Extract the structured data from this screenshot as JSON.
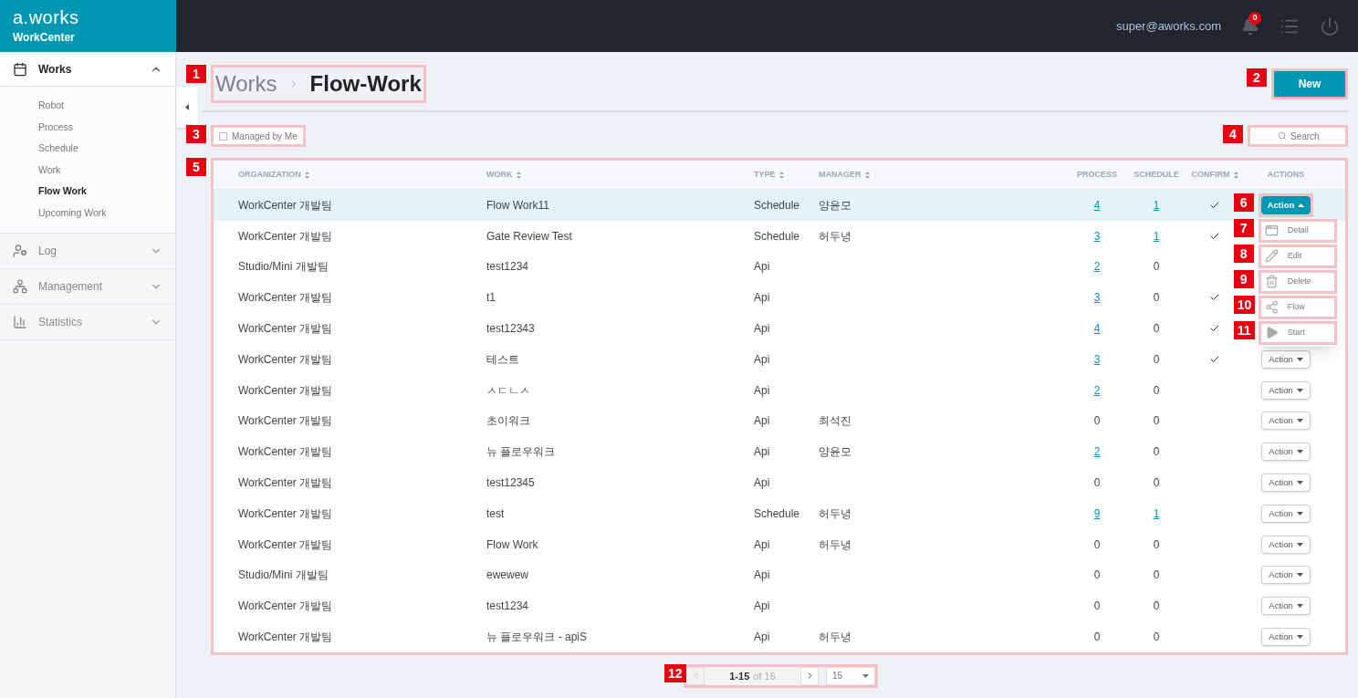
{
  "brand": {
    "logo": "a.works",
    "product": "WorkCenter"
  },
  "header": {
    "user": "super@aworks.com",
    "notification_count": "0"
  },
  "sidebar": {
    "sections": [
      {
        "kind": "calendar",
        "label": "Works",
        "expanded": true,
        "children": [
          {
            "label": "Robot",
            "selected": false
          },
          {
            "label": "Process",
            "selected": false
          },
          {
            "label": "Schedule",
            "selected": false
          },
          {
            "label": "Work",
            "selected": false
          },
          {
            "label": "Flow Work",
            "selected": true
          },
          {
            "label": "Upcoming Work",
            "selected": false
          }
        ]
      },
      {
        "kind": "user",
        "label": "Log",
        "expanded": false
      },
      {
        "kind": "hierarchy",
        "label": "Management",
        "expanded": false
      },
      {
        "kind": "chart",
        "label": "Statistics",
        "expanded": false
      }
    ]
  },
  "breadcrumb": {
    "parent": "Works",
    "current": "Flow-Work",
    "callout": "1"
  },
  "new_button": {
    "label": "New",
    "callout": "2"
  },
  "managed_filter": {
    "label": "Managed by Me",
    "checked": false,
    "callout": "3"
  },
  "search": {
    "placeholder": "Search",
    "callout": "4"
  },
  "table": {
    "callout": "5",
    "columns": [
      {
        "label": "ORGANIZATION",
        "sortable": true
      },
      {
        "label": "WORK",
        "sortable": true
      },
      {
        "label": "TYPE",
        "sortable": true
      },
      {
        "label": "MANAGER",
        "sortable": true
      },
      {
        "label": "PROCESS",
        "sortable": false
      },
      {
        "label": "SCHEDULE",
        "sortable": false
      },
      {
        "label": "CONFIRM",
        "sortable": true
      },
      {
        "label": "ACTIONS",
        "sortable": false
      }
    ],
    "rows": [
      {
        "selected": true,
        "organization": "WorkCenter 개발팀",
        "work": "Flow Work11",
        "type": "Schedule",
        "manager": "양윤모",
        "process": {
          "value": "4",
          "link": true
        },
        "schedule": {
          "value": "1",
          "link": true
        },
        "confirmed": true,
        "action": {
          "label": "Action",
          "open": true,
          "callout": "6"
        }
      },
      {
        "selected": false,
        "organization": "WorkCenter 개발팀",
        "work": "Gate Review Test",
        "type": "Schedule",
        "manager": "허두녕",
        "process": {
          "value": "3",
          "link": true
        },
        "schedule": {
          "value": "1",
          "link": true
        },
        "confirmed": true
      },
      {
        "selected": false,
        "organization": "Studio/Mini 개발팀",
        "work": "test1234",
        "type": "Api",
        "process": {
          "value": "2",
          "link": true
        },
        "schedule": {
          "value": "0",
          "link": false
        },
        "confirmed": false
      },
      {
        "selected": false,
        "organization": "WorkCenter 개발팀",
        "work": "t1",
        "type": "Api",
        "process": {
          "value": "3",
          "link": true
        },
        "schedule": {
          "value": "0",
          "link": false
        },
        "confirmed": true
      },
      {
        "selected": false,
        "organization": "WorkCenter 개발팀",
        "work": "test12343",
        "type": "Api",
        "process": {
          "value": "4",
          "link": true
        },
        "schedule": {
          "value": "0",
          "link": false
        },
        "confirmed": true
      },
      {
        "selected": false,
        "organization": "WorkCenter 개발팀",
        "work": "테스트",
        "type": "Api",
        "process": {
          "value": "3",
          "link": true
        },
        "schedule": {
          "value": "0",
          "link": false
        },
        "confirmed": true,
        "action": {
          "label": "Action",
          "open": false
        }
      },
      {
        "selected": false,
        "organization": "WorkCenter 개발팀",
        "work": "ㅅㄷㄴㅅ",
        "type": "Api",
        "process": {
          "value": "2",
          "link": true
        },
        "schedule": {
          "value": "0",
          "link": false
        },
        "confirmed": false,
        "action": {
          "label": "Action",
          "open": false
        }
      },
      {
        "selected": false,
        "organization": "WorkCenter 개발팀",
        "work": "초이워크",
        "type": "Api",
        "manager": "최석진",
        "process": {
          "value": "0",
          "link": false
        },
        "schedule": {
          "value": "0",
          "link": false
        },
        "confirmed": false,
        "action": {
          "label": "Action",
          "open": false
        }
      },
      {
        "selected": false,
        "organization": "WorkCenter 개발팀",
        "work": "뉴 플로우워크",
        "type": "Api",
        "manager": "양윤모",
        "process": {
          "value": "2",
          "link": true
        },
        "schedule": {
          "value": "0",
          "link": false
        },
        "confirmed": false,
        "action": {
          "label": "Action",
          "open": false
        }
      },
      {
        "selected": false,
        "organization": "WorkCenter 개발팀",
        "work": "test12345",
        "type": "Api",
        "process": {
          "value": "0",
          "link": false
        },
        "schedule": {
          "value": "0",
          "link": false
        },
        "confirmed": false,
        "action": {
          "label": "Action",
          "open": false
        }
      },
      {
        "selected": false,
        "organization": "WorkCenter 개발팀",
        "work": "test",
        "type": "Schedule",
        "manager": "허두녕",
        "process": {
          "value": "9",
          "link": true
        },
        "schedule": {
          "value": "1",
          "link": true
        },
        "confirmed": false,
        "action": {
          "label": "Action",
          "open": false
        }
      },
      {
        "selected": false,
        "organization": "WorkCenter 개발팀",
        "work": "Flow Work",
        "type": "Api",
        "manager": "허두녕",
        "process": {
          "value": "0",
          "link": false
        },
        "schedule": {
          "value": "0",
          "link": false
        },
        "confirmed": false,
        "action": {
          "label": "Action",
          "open": false
        }
      },
      {
        "selected": false,
        "organization": "Studio/Mini 개발팀",
        "work": "ewewew",
        "type": "Api",
        "process": {
          "value": "0",
          "link": false
        },
        "schedule": {
          "value": "0",
          "link": false
        },
        "confirmed": false,
        "action": {
          "label": "Action",
          "open": false
        }
      },
      {
        "selected": false,
        "organization": "WorkCenter 개발팀",
        "work": "test1234",
        "type": "Api",
        "process": {
          "value": "0",
          "link": false
        },
        "schedule": {
          "value": "0",
          "link": false
        },
        "confirmed": false,
        "action": {
          "label": "Action",
          "open": false
        }
      },
      {
        "selected": false,
        "organization": "WorkCenter 개발팀",
        "work": "뉴 플로우워크 - apiS",
        "type": "Api",
        "manager": "허두녕",
        "process": {
          "value": "0",
          "link": false
        },
        "schedule": {
          "value": "0",
          "link": false
        },
        "confirmed": false,
        "action": {
          "label": "Action",
          "open": false
        }
      }
    ]
  },
  "action_menu": {
    "items": [
      {
        "kind": "detail",
        "label": "Detail",
        "callout": "7"
      },
      {
        "kind": "edit",
        "label": "Edit",
        "callout": "8"
      },
      {
        "kind": "delete",
        "label": "Delete",
        "callout": "9"
      },
      {
        "kind": "flow",
        "label": "Flow",
        "callout": "10"
      },
      {
        "kind": "start",
        "label": "Start",
        "callout": "11"
      }
    ]
  },
  "pagination": {
    "range": "1-15",
    "total": "of 16",
    "page_size": "15",
    "prev_disabled": true,
    "next_disabled": false,
    "callout": "12"
  }
}
